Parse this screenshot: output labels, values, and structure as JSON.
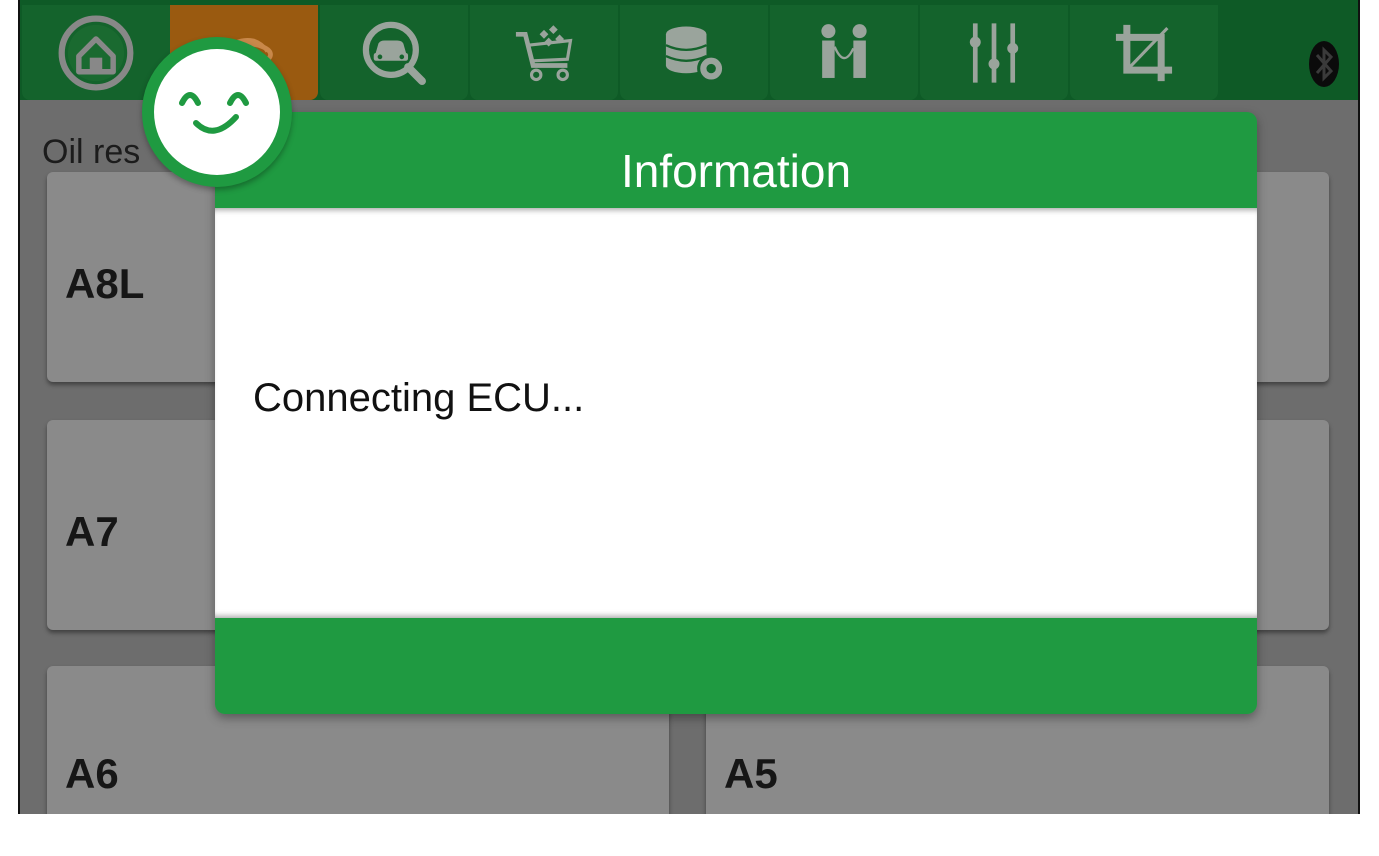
{
  "toolbar": {
    "tabs": [
      {
        "name": "home-icon",
        "active": false
      },
      {
        "name": "car-model-icon",
        "active": true
      },
      {
        "name": "vehicle-search-icon",
        "active": false
      },
      {
        "name": "shopping-cart-icon",
        "active": false
      },
      {
        "name": "database-settings-icon",
        "active": false
      },
      {
        "name": "people-connect-icon",
        "active": false
      },
      {
        "name": "sliders-icon",
        "active": false
      },
      {
        "name": "crop-icon",
        "active": false
      }
    ],
    "bluetooth_icon": "bluetooth-icon"
  },
  "content": {
    "section_label": "Oil res",
    "cards": [
      {
        "label": "A8L"
      },
      {
        "label": "A7"
      },
      {
        "label": "A6"
      },
      {
        "label": "A5"
      }
    ]
  },
  "dialog": {
    "title": "Information",
    "message": "Connecting ECU..."
  },
  "colors": {
    "accent_green": "#1f9a41",
    "toolbar_dark": "#0e5a26",
    "active_tab": "#9a5a10",
    "overlay_grey": "#6d6d6d"
  }
}
